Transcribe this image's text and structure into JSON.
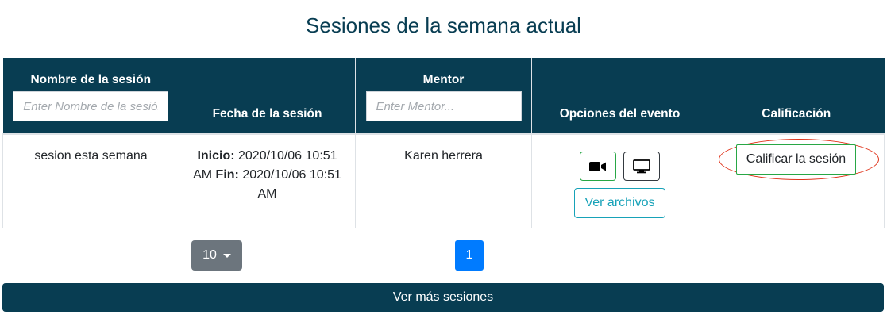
{
  "page_title": "Sesiones de la semana actual",
  "table": {
    "columns": [
      {
        "label": "Nombre de la sesión",
        "filter_placeholder": "Enter Nombre de la sesión..."
      },
      {
        "label": "Fecha de la sesión"
      },
      {
        "label": "Mentor",
        "filter_placeholder": "Enter Mentor..."
      },
      {
        "label": "Opciones del evento"
      },
      {
        "label": "Calificación"
      }
    ],
    "rows": [
      {
        "session_name": "sesion esta semana",
        "start_label": "Inicio:",
        "start_value": "2020/10/06 10:51 AM",
        "end_label": "Fin:",
        "end_value": "2020/10/06 10:51 AM",
        "mentor": "Karen herrera",
        "video_icon": "video-camera-icon",
        "screen_icon": "monitor-icon",
        "files_button": "Ver archivos",
        "rate_button": "Calificar la sesión"
      }
    ]
  },
  "pagination": {
    "page_size": "10",
    "current_page": "1"
  },
  "more_button": "Ver más sesiones",
  "colors": {
    "header": "#083d52",
    "primary": "#007bff",
    "secondary": "#6c757d",
    "success": "#28a745",
    "info": "#17a2b8",
    "highlight": "#e0341b"
  }
}
